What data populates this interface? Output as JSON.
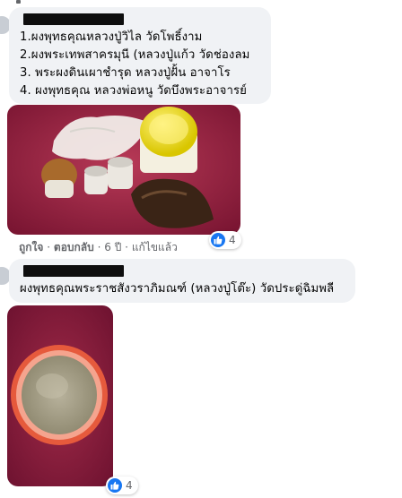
{
  "comments": [
    {
      "lines": [
        "1.ผงพุทธคุณหลวงปู่วิไล วัดโพธิ์งาม",
        "2.ผงพระเทพสาครมุนี (หลวงปู่แก้ว วัดช่องลม",
        "3. พระผงดินเผาชำรุด หลวงปู่ฝั้น อาจาโร",
        "4. ผงพุทธคุณ หลวงพ่อหนู วัดบึงพระอาจารย์"
      ],
      "photo_icon": "photo-amulet-powder-jars",
      "actions": {
        "like": "ถูกใจ",
        "reply": "ตอบกลับ",
        "age": "6 ปี",
        "edited": "แก้ไขแล้ว",
        "separator": "·"
      },
      "reaction_count": "4"
    },
    {
      "lines": [
        "ผงพุทธคุณพระราชสังวราภิมณฑ์ (หลวงปู่โต๊ะ) วัดประดู่ฉิมพลี"
      ],
      "photo_icon": "photo-powder-in-jar",
      "reaction_count": "4"
    }
  ],
  "colors": {
    "bubble": "#f0f2f5",
    "meta_text": "#65676b",
    "like_blue": "#1877f2",
    "photo_background": "#8b1d3b"
  }
}
